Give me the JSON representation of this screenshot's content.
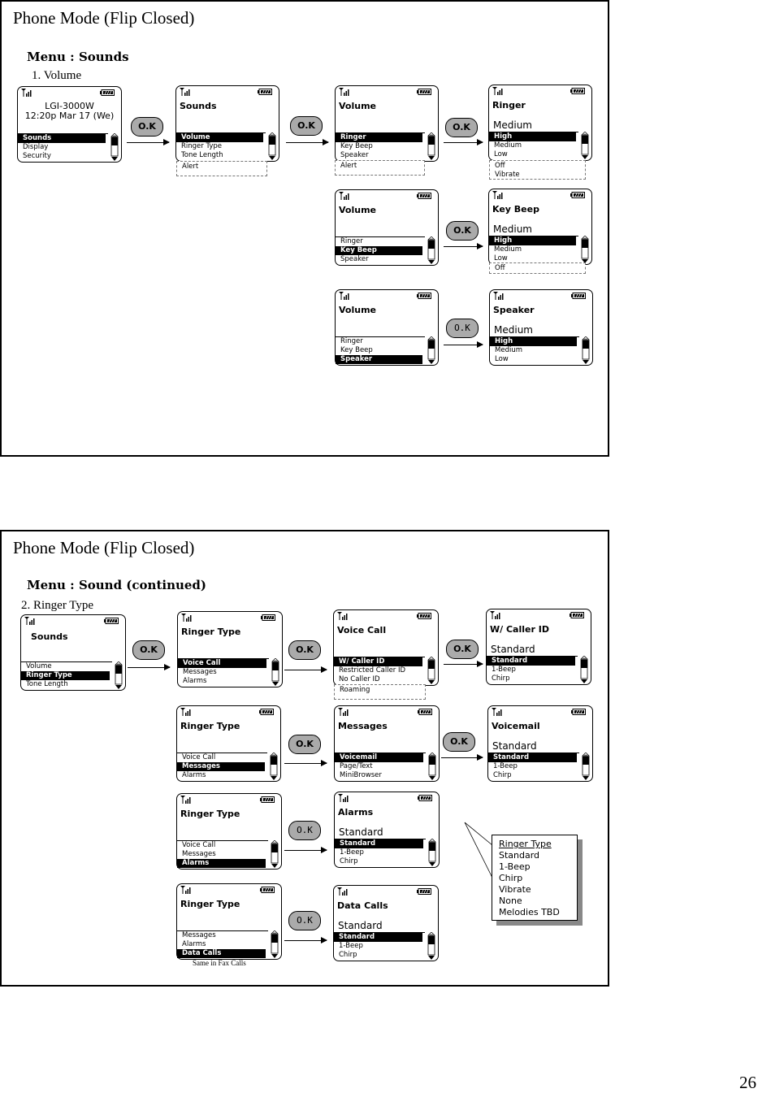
{
  "page_number": "26",
  "panels": [
    {
      "title": "Phone Mode (Flip Closed)",
      "menu_heading": "Menu : Sounds",
      "sub_heading": "1. Volume"
    },
    {
      "title": "Phone Mode (Flip Closed)",
      "menu_heading": "Menu : Sound (continued)",
      "sub_heading": "2. Ringer Type"
    }
  ],
  "ok_label": "O.K",
  "screens": {
    "idle": {
      "line1": "LGI-3000W",
      "line2": "12:20p Mar 17 (We)",
      "items": [
        "Sounds",
        "Display",
        "Security"
      ],
      "selected": 0
    },
    "sounds1": {
      "title": "Sounds",
      "items": [
        "Volume",
        "Ringer Type",
        "Tone Length"
      ],
      "selected": 0,
      "extra": [
        "Alert"
      ]
    },
    "volume1": {
      "title": "Volume",
      "items": [
        "Ringer",
        "Key Beep",
        "Speaker"
      ],
      "selected": 0,
      "extra": [
        "Alert"
      ]
    },
    "ringer": {
      "title": "Ringer",
      "current": "Medium",
      "items": [
        "High",
        "Medium",
        "Low"
      ],
      "selected": 0,
      "extra": [
        "Off",
        "Vibrate"
      ]
    },
    "volume2": {
      "title": "Volume",
      "items": [
        "Ringer",
        "Key Beep",
        "Speaker"
      ],
      "selected": 1
    },
    "keybeep": {
      "title": "Key Beep",
      "current": "Medium",
      "items": [
        "High",
        "Medium",
        "Low"
      ],
      "selected": 0,
      "extra": [
        "Off"
      ]
    },
    "volume3": {
      "title": "Volume",
      "items": [
        "Ringer",
        "Key Beep",
        "Speaker"
      ],
      "selected": 2
    },
    "speaker": {
      "title": "Speaker",
      "current": "Medium",
      "items": [
        "High",
        "Medium",
        "Low"
      ],
      "selected": 0
    },
    "sounds2": {
      "title": "Sounds",
      "items": [
        "Volume",
        "Ringer Type",
        "Tone Length"
      ],
      "selected": 1
    },
    "ringertype1": {
      "title": "Ringer Type",
      "items": [
        "Voice Call",
        "Messages",
        "Alarms"
      ],
      "selected": 0
    },
    "voicecall": {
      "title": "Voice Call",
      "items": [
        "W/  Caller ID",
        "Restricted Caller ID",
        "No Caller ID"
      ],
      "selected": 0,
      "extra": [
        "Roaming"
      ]
    },
    "callerid": {
      "title": "W/  Caller ID",
      "current": "Standard",
      "items": [
        "Standard",
        "1-Beep",
        "Chirp"
      ],
      "selected": 0
    },
    "ringertype2": {
      "title": "Ringer Type",
      "items": [
        "Voice Call",
        "Messages",
        "Alarms"
      ],
      "selected": 1
    },
    "messages": {
      "title": "Messages",
      "items": [
        "Voicemail",
        "Page/Text",
        "MiniBrowser"
      ],
      "selected": 0
    },
    "voicemail": {
      "title": "Voicemail",
      "current": "Standard",
      "items": [
        "Standard",
        "1-Beep",
        "Chirp"
      ],
      "selected": 0
    },
    "ringertype3": {
      "title": "Ringer Type",
      "items": [
        "Voice Call",
        "Messages",
        "Alarms"
      ],
      "selected": 2
    },
    "alarms": {
      "title": "Alarms",
      "current": "Standard",
      "items": [
        "Standard",
        "1-Beep",
        "Chirp"
      ],
      "selected": 0
    },
    "ringertype4": {
      "title": "Ringer Type",
      "items": [
        "Messages",
        "Alarms",
        "Data Calls"
      ],
      "selected": 2,
      "note": "Same in Fax Calls"
    },
    "datacalls": {
      "title": "Data Calls",
      "current": "Standard",
      "items": [
        "Standard",
        "1-Beep",
        "Chirp"
      ],
      "selected": 0
    }
  },
  "callout": {
    "heading": "Ringer Type",
    "items": [
      "Standard",
      "1-Beep",
      "Chirp",
      "Vibrate",
      "None",
      "Melodies TBD"
    ]
  }
}
